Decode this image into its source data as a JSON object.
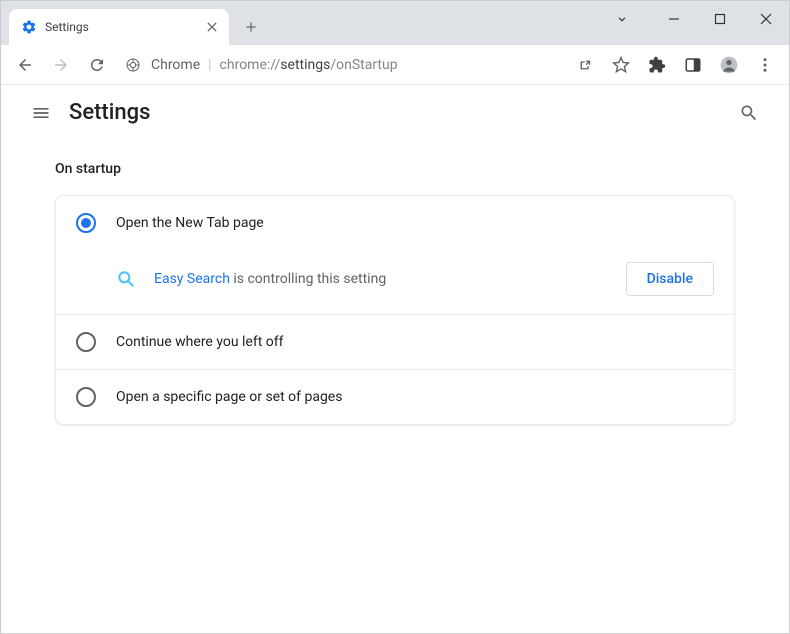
{
  "window": {
    "tab_title": "Settings"
  },
  "omnibox": {
    "security_label": "Chrome",
    "url_prefix": "chrome://",
    "url_mid": "settings",
    "url_suffix": "/onStartup"
  },
  "header": {
    "title": "Settings"
  },
  "onStartup": {
    "section_title": "On startup",
    "options": [
      {
        "label": "Open the New Tab page",
        "selected": true
      },
      {
        "label": "Continue where you left off",
        "selected": false
      },
      {
        "label": "Open a specific page or set of pages",
        "selected": false
      }
    ],
    "extension_notice": {
      "extension_name": "Easy Search",
      "message_suffix": " is controlling this setting",
      "disable_button": "Disable"
    }
  }
}
